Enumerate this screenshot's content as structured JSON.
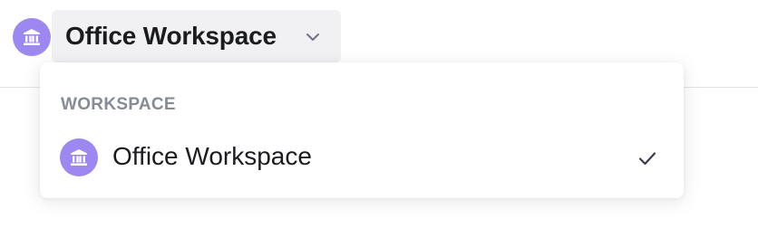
{
  "colors": {
    "avatar_bg": "#9d87f1",
    "avatar_fg": "#ffffff",
    "trigger_bg": "#f1f1f3",
    "text_primary": "#1b1c20",
    "section_label": "#868b96",
    "check": "#3b3e4a"
  },
  "workspace_switcher": {
    "avatar_icon": "bank-building-icon",
    "label": "Office Workspace",
    "dropdown_icon": "chevron-down-icon"
  },
  "menu": {
    "section_title": "WORKSPACE",
    "items": [
      {
        "icon": "bank-building-icon",
        "label": "Office Workspace",
        "selected": true,
        "selected_icon": "checkmark-icon"
      }
    ]
  }
}
